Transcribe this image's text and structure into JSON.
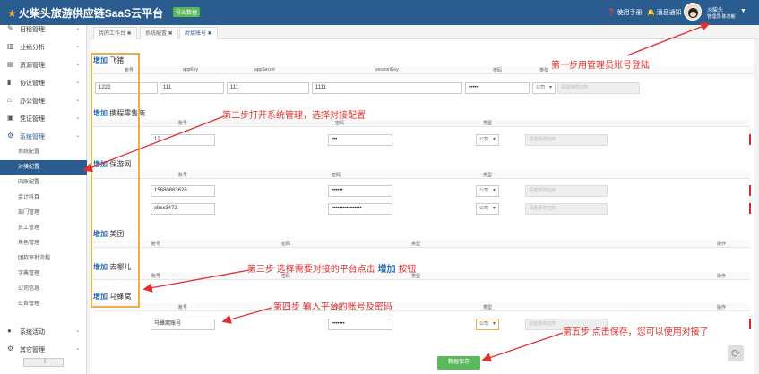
{
  "header": {
    "title": "火柴头旅游供应链SaaS云平台",
    "tag": "导出数据",
    "help": "使用手册",
    "notify": "消息通知",
    "user_name": "火柴头",
    "user_role": "管理员-陈浩郁"
  },
  "sidebar": {
    "items": [
      {
        "icon": "✎",
        "label": "日程管理"
      },
      {
        "icon": "▥",
        "label": "业绩分析"
      },
      {
        "icon": "▤",
        "label": "资源管理"
      },
      {
        "icon": "▮",
        "label": "协议管理"
      },
      {
        "icon": "⌂",
        "label": "办公管理"
      },
      {
        "icon": "▣",
        "label": "凭证管理"
      },
      {
        "icon": "⚙",
        "label": "系统管理"
      }
    ],
    "subitems": [
      "系统配置",
      "对接配置",
      "内账配置",
      "会计科目",
      "部门管理",
      "员工管理",
      "角色管理",
      "团款审批流程",
      "字典管理",
      "公司信息",
      "公告管理"
    ],
    "bottom_items": [
      {
        "icon": "●",
        "label": "系统活动"
      },
      {
        "icon": "⚙",
        "label": "其它管理"
      }
    ],
    "scroll": "《"
  },
  "tabs": [
    {
      "label": "我的工作台 ✖"
    },
    {
      "label": "系统配置 ✖"
    },
    {
      "label": "对接账号 ✖"
    }
  ],
  "sections": {
    "feizhu": {
      "add": "增加",
      "name": "飞猪",
      "headers": [
        "账号",
        "appKey",
        "appSecret",
        "sessionKey",
        "密码",
        "类型"
      ],
      "account": "1222",
      "appKey": "111",
      "appSecret": "111",
      "sessionKey": "1111",
      "password": "•••••",
      "type": "公司",
      "ph": "请选择供应商"
    },
    "ctrip": {
      "add": "增加",
      "name": "携程零售商",
      "headers": [
        "账号",
        "密码",
        "类型"
      ],
      "account": "12",
      "password": "•••",
      "type": "公司",
      "ph": "请选择供应商"
    },
    "baoyou": {
      "add": "增加",
      "name": "保游网",
      "headers": [
        "账号",
        "密码",
        "类型"
      ],
      "rows": [
        {
          "account": "15680863626",
          "password": "••••••",
          "type": "公司",
          "ph": "请选择供应商"
        },
        {
          "account": "xbxx3472",
          "password": "••••••••••••••••",
          "type": "公司",
          "ph": "请选择供应商"
        }
      ]
    },
    "meituan": {
      "add": "增加",
      "name": "美团",
      "headers": [
        "账号",
        "密码",
        "类型",
        "操作"
      ]
    },
    "qunar": {
      "add": "增加",
      "name": "去哪儿",
      "headers": [
        "账号",
        "密码",
        "类型",
        "操作"
      ]
    },
    "mafengwo": {
      "add": "增加",
      "name": "马蜂窝",
      "headers": [
        "账号",
        "密码",
        "类型",
        "操作"
      ],
      "account": "马蜂窝账号",
      "password": "•••••••",
      "type": "公司",
      "ph": "请选择供应商"
    }
  },
  "save_label": "数据保存",
  "annotations": {
    "step1": "第一步用管理员账号登陆",
    "step2": "第二步打开系统管理，选择对接配置",
    "step3_pre": "第三步 选择需要对接的平台点击 ",
    "step3_add": "增加",
    "step3_post": " 按钮",
    "step4": "第四步 输入平台的账号及密码",
    "step5": "第五步 点击保存，您可以使用对接了"
  },
  "colors": {
    "topbar": "#2b5c8f",
    "annotation": "#e03030",
    "add_link": "#2b6fb5",
    "save": "#5cb85c",
    "highlight_box": "#f0ad4e"
  }
}
